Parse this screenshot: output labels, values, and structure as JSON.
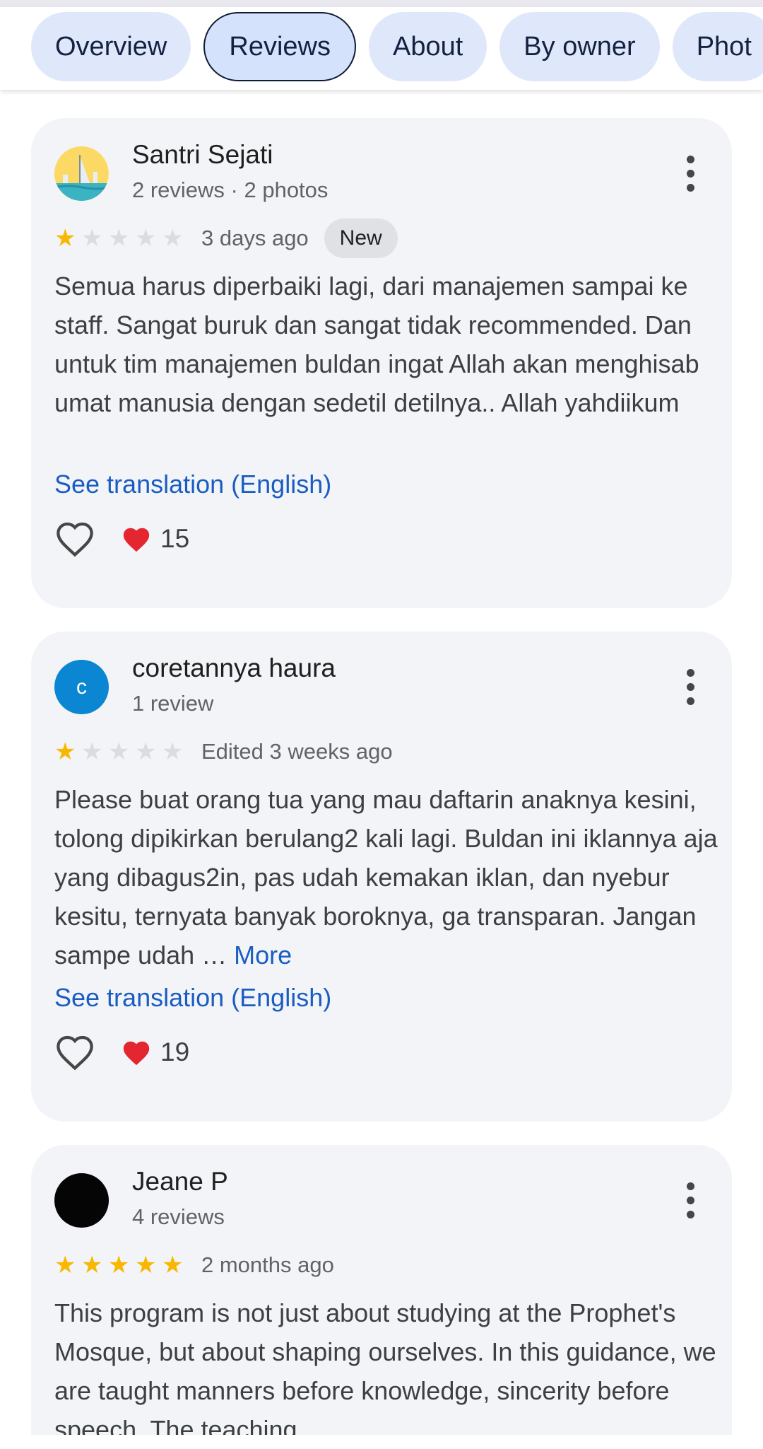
{
  "tabs": [
    {
      "label": "Overview"
    },
    {
      "label": "Reviews",
      "active": true
    },
    {
      "label": "About"
    },
    {
      "label": "By owner"
    },
    {
      "label": "Phot"
    }
  ],
  "reviews": [
    {
      "name": "Santri Sejati",
      "meta": "2 reviews · 2 photos",
      "rating": 1,
      "date": "3 days ago",
      "badge": "New",
      "text": "Semua harus diperbaiki lagi, dari manajemen sampai ke staff. Sangat buruk dan sangat tidak recommended. Dan untuk tim manajemen buldan ingat Allah akan menghisab umat manusia dengan sedetil detilnya.. Allah yahdiikum",
      "translation": "See translation (English)",
      "reaction_count": "15"
    },
    {
      "name": "coretannya haura",
      "meta": "1 review",
      "avatar_letter": "c",
      "rating": 1,
      "date": "Edited 3 weeks ago",
      "text": "Please buat orang tua yang mau daftarin anaknya kesini, tolong dipikirkan berulang2 kali lagi. Buldan ini iklannya aja yang dibagus2in, pas udah kemakan iklan, dan nyebur kesitu, ternyata banyak boroknya, ga transparan. Jangan sampe udah …",
      "more": "More",
      "translation": "See translation (English)",
      "reaction_count": "19"
    },
    {
      "name": "Jeane P",
      "meta": "4 reviews",
      "rating": 5,
      "date": "2 months ago",
      "text": "This program is not just about studying at the Prophet's Mosque, but about shaping ourselves. In this guidance, we are taught manners before knowledge, sincerity before speech. The teaching"
    }
  ],
  "colors": {
    "star_filled": "#f8b700",
    "star_empty": "#dadce0",
    "link": "#1a5dc2",
    "tab_bg": "#dfe8fa",
    "card_bg": "#f3f4f7",
    "avatar_c": "#0a86d3"
  }
}
